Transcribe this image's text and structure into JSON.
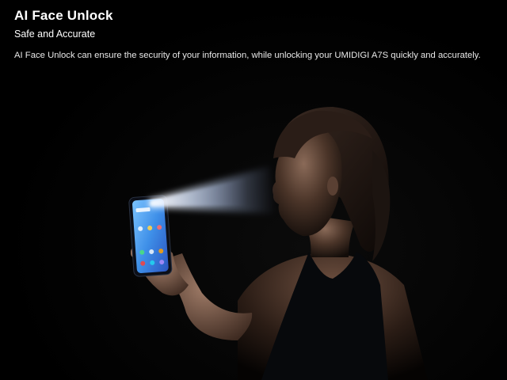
{
  "header": {
    "title": "AI Face Unlock",
    "subtitle": "Safe and Accurate",
    "description": "AI Face Unlock can ensure the security of your information, while unlocking your UMIDIGI A7S quickly and accurately."
  },
  "illustration": {
    "subject": "woman-holding-phone-face-scan",
    "light_beam_color": "#cfe0ff",
    "phone_screen_color": "#3e8fe8"
  },
  "colors": {
    "background": "#000000",
    "text": "#ffffff"
  }
}
